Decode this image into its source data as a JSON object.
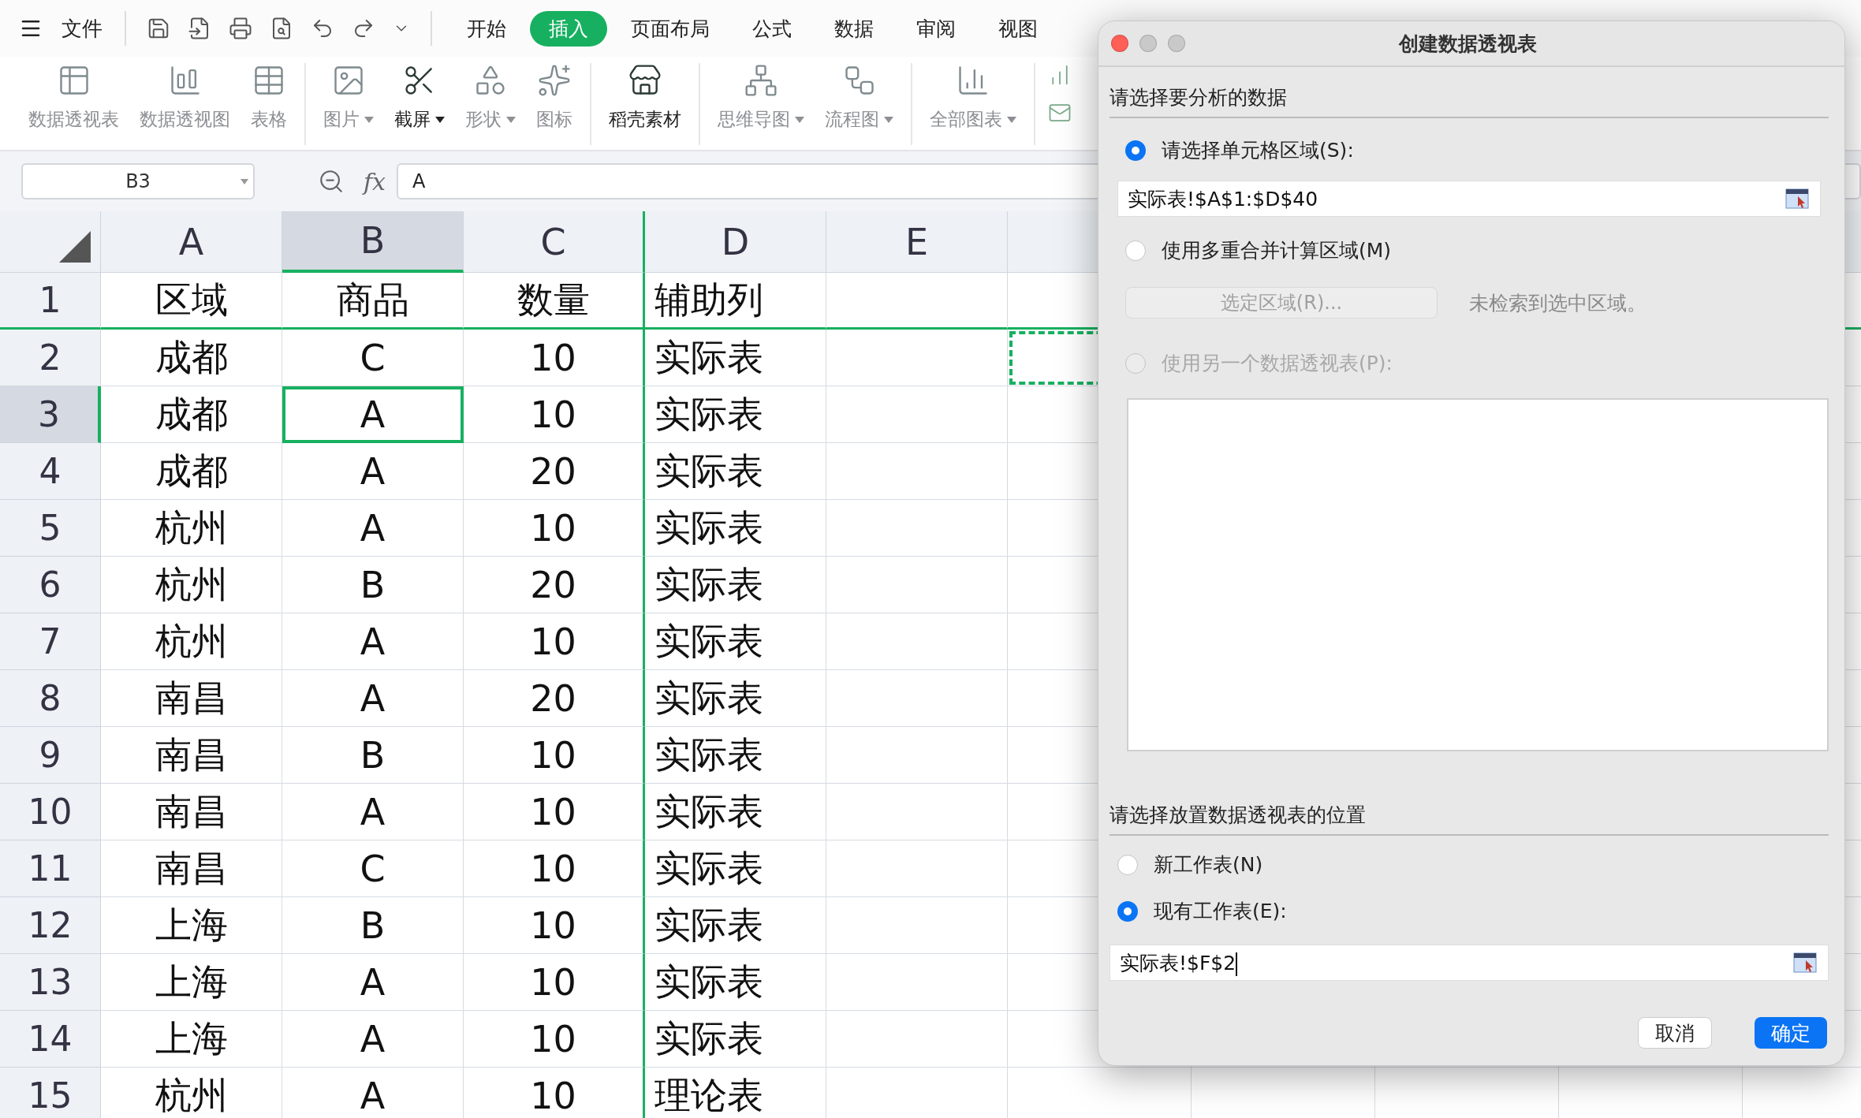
{
  "menu": {
    "label": "文件"
  },
  "tabs": [
    {
      "label": "开始",
      "selected": false
    },
    {
      "label": "插入",
      "selected": true
    },
    {
      "label": "页面布局",
      "selected": false
    },
    {
      "label": "公式",
      "selected": false
    },
    {
      "label": "数据",
      "selected": false
    },
    {
      "label": "审阅",
      "selected": false
    },
    {
      "label": "视图",
      "selected": false
    }
  ],
  "ribbon": [
    [
      {
        "label": "数据透视表",
        "disabled": true,
        "dropdown": false
      },
      {
        "label": "数据透视图",
        "disabled": true,
        "dropdown": false
      },
      {
        "label": "表格",
        "disabled": true,
        "dropdown": false
      }
    ],
    [
      {
        "label": "图片",
        "disabled": true,
        "dropdown": true
      },
      {
        "label": "截屏",
        "disabled": false,
        "dropdown": true
      },
      {
        "label": "形状",
        "disabled": true,
        "dropdown": true
      },
      {
        "label": "图标",
        "disabled": true,
        "dropdown": false
      }
    ],
    [
      {
        "label": "稻壳素材",
        "disabled": false,
        "dropdown": false
      }
    ],
    [
      {
        "label": "思维导图",
        "disabled": true,
        "dropdown": true
      },
      {
        "label": "流程图",
        "disabled": true,
        "dropdown": true
      }
    ],
    [
      {
        "label": "全部图表",
        "disabled": true,
        "dropdown": true
      }
    ]
  ],
  "formula_bar": {
    "name_box": "B3",
    "fx": "fx",
    "value": "A"
  },
  "grid": {
    "columns": [
      {
        "letter": "A",
        "selected": false
      },
      {
        "letter": "B",
        "selected": true
      },
      {
        "letter": "C",
        "selected": false
      },
      {
        "letter": "D",
        "selected": false
      },
      {
        "letter": "E",
        "selected": false
      }
    ],
    "marquee_column_after_letters": true,
    "rows": [
      {
        "number": "1",
        "selected": false,
        "cells": [
          "区域",
          "商品",
          "数量",
          "辅助列"
        ]
      },
      {
        "number": "2",
        "selected": false,
        "marquee": true,
        "cells": [
          "成都",
          "C",
          "10",
          "实际表"
        ]
      },
      {
        "number": "3",
        "selected": true,
        "cells": [
          "成都",
          "A",
          "10",
          "实际表"
        ]
      },
      {
        "number": "4",
        "selected": false,
        "cells": [
          "成都",
          "A",
          "20",
          "实际表"
        ]
      },
      {
        "number": "5",
        "selected": false,
        "cells": [
          "杭州",
          "A",
          "10",
          "实际表"
        ]
      },
      {
        "number": "6",
        "selected": false,
        "cells": [
          "杭州",
          "B",
          "20",
          "实际表"
        ]
      },
      {
        "number": "7",
        "selected": false,
        "cells": [
          "杭州",
          "A",
          "10",
          "实际表"
        ]
      },
      {
        "number": "8",
        "selected": false,
        "cells": [
          "南昌",
          "A",
          "20",
          "实际表"
        ]
      },
      {
        "number": "9",
        "selected": false,
        "cells": [
          "南昌",
          "B",
          "10",
          "实际表"
        ]
      },
      {
        "number": "10",
        "selected": false,
        "cells": [
          "南昌",
          "A",
          "10",
          "实际表"
        ]
      },
      {
        "number": "11",
        "selected": false,
        "cells": [
          "南昌",
          "C",
          "10",
          "实际表"
        ]
      },
      {
        "number": "12",
        "selected": false,
        "cells": [
          "上海",
          "B",
          "10",
          "实际表"
        ]
      },
      {
        "number": "13",
        "selected": false,
        "cells": [
          "上海",
          "A",
          "10",
          "实际表"
        ]
      },
      {
        "number": "14",
        "selected": false,
        "cells": [
          "上海",
          "A",
          "10",
          "实际表"
        ]
      },
      {
        "number": "15",
        "selected": false,
        "cells": [
          "杭州",
          "A",
          "10",
          "理论表"
        ]
      }
    ]
  },
  "dialog": {
    "title": "创建数据透视表",
    "source": {
      "heading": "请选择要分析的数据",
      "options": [
        {
          "label": "请选择单元格区域(S):",
          "selected": true,
          "disabled": false
        },
        {
          "label": "使用多重合并计算区域(M)",
          "selected": false,
          "disabled": false
        },
        {
          "label": "使用另一个数据透视表(P):",
          "selected": false,
          "disabled": true
        }
      ],
      "range_value": "实际表!$A$1:$D$40",
      "select_button": {
        "label": "选定区域(R)...",
        "disabled": true
      },
      "note": "未检索到选中区域。"
    },
    "destination": {
      "heading": "请选择放置数据透视表的位置",
      "options": [
        {
          "label": "新工作表(N)",
          "selected": false,
          "disabled": false
        },
        {
          "label": "现有工作表(E):",
          "selected": true,
          "disabled": false
        }
      ],
      "location_value": "实际表!$F$2"
    },
    "buttons": [
      {
        "label": "取消",
        "primary": false
      },
      {
        "label": "确定",
        "primary": true
      }
    ]
  }
}
